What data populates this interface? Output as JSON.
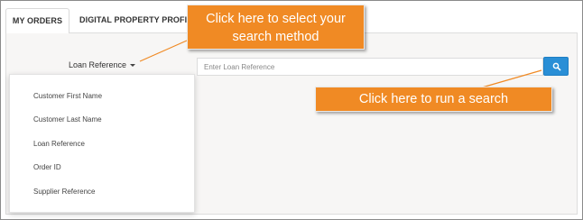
{
  "tabs": [
    {
      "label": "MY ORDERS",
      "active": true
    },
    {
      "label": "DIGITAL PROPERTY PROFILER",
      "active": false
    }
  ],
  "search_method": {
    "selected": "Loan Reference",
    "options": [
      "Customer First Name",
      "Customer Last Name",
      "Loan Reference",
      "Order ID",
      "Supplier Reference"
    ]
  },
  "search": {
    "placeholder": "Enter Loan Reference",
    "button_icon": "search-icon"
  },
  "callouts": {
    "method_line1": "Click here to select your",
    "method_line2": "search method",
    "run_search": "Click here to run a search"
  },
  "colors": {
    "callout": "#f08a24",
    "search_button": "#2a8fd6",
    "panel": "#f7f6f5"
  }
}
